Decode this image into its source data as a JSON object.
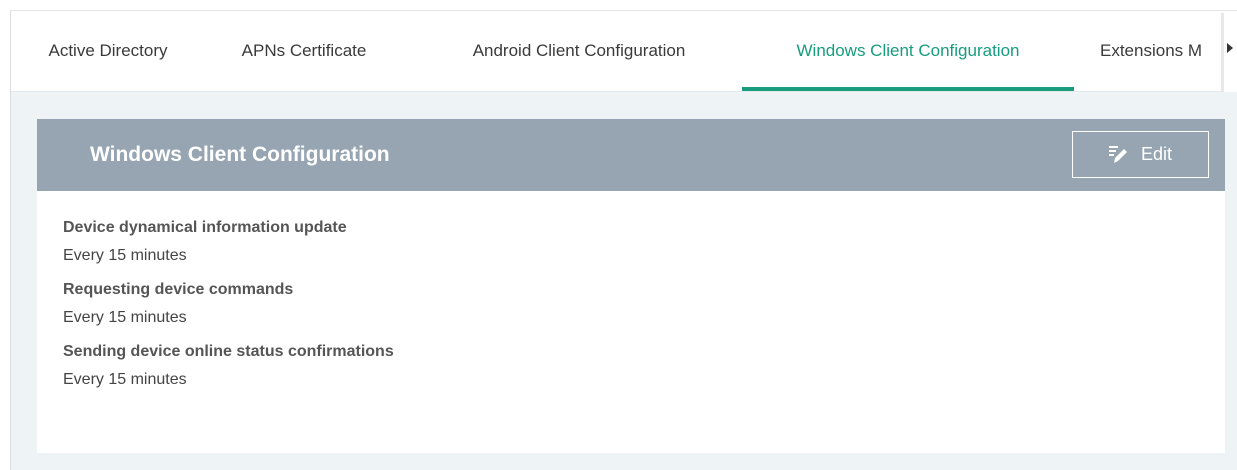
{
  "tabs": [
    {
      "label": "Active Directory",
      "active": false
    },
    {
      "label": "APNs Certificate",
      "active": false
    },
    {
      "label": "Android Client Configuration",
      "active": false
    },
    {
      "label": "Windows Client Configuration",
      "active": true
    },
    {
      "label": "Extensions M",
      "active": false
    }
  ],
  "panel": {
    "title": "Windows Client Configuration",
    "edit_label": "Edit",
    "settings": [
      {
        "label": "Device dynamical information update",
        "value": "Every 15 minutes"
      },
      {
        "label": "Requesting device commands",
        "value": "Every 15 minutes"
      },
      {
        "label": "Sending device online status confirmations",
        "value": "Every 15 minutes"
      }
    ]
  },
  "colors": {
    "accent": "#179c7d",
    "panel_header": "#96a5b1",
    "content_background": "#eef3f6"
  },
  "icons": {
    "edit": "pencil-icon",
    "scroll": "scroll-right-icon"
  }
}
